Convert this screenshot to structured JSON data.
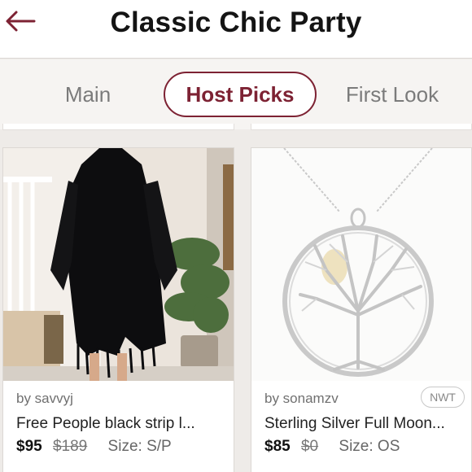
{
  "header": {
    "title": "Classic Chic Party",
    "back_icon": "arrow-left-icon",
    "accent_color": "#7d2233"
  },
  "tabs": [
    {
      "label": "Main",
      "active": false
    },
    {
      "label": "Host Picks",
      "active": true
    },
    {
      "label": "First Look",
      "active": false
    }
  ],
  "listings": [
    {
      "seller": "by savvyj",
      "title": "Free People black strip l...",
      "price": "$95",
      "original_price": "$189",
      "size": "Size: S/P",
      "badge": ""
    },
    {
      "seller": "by sonamzv",
      "title": "Sterling Silver Full Moon...",
      "price": "$85",
      "original_price": "$0",
      "size": "Size: OS",
      "badge": "NWT"
    }
  ]
}
